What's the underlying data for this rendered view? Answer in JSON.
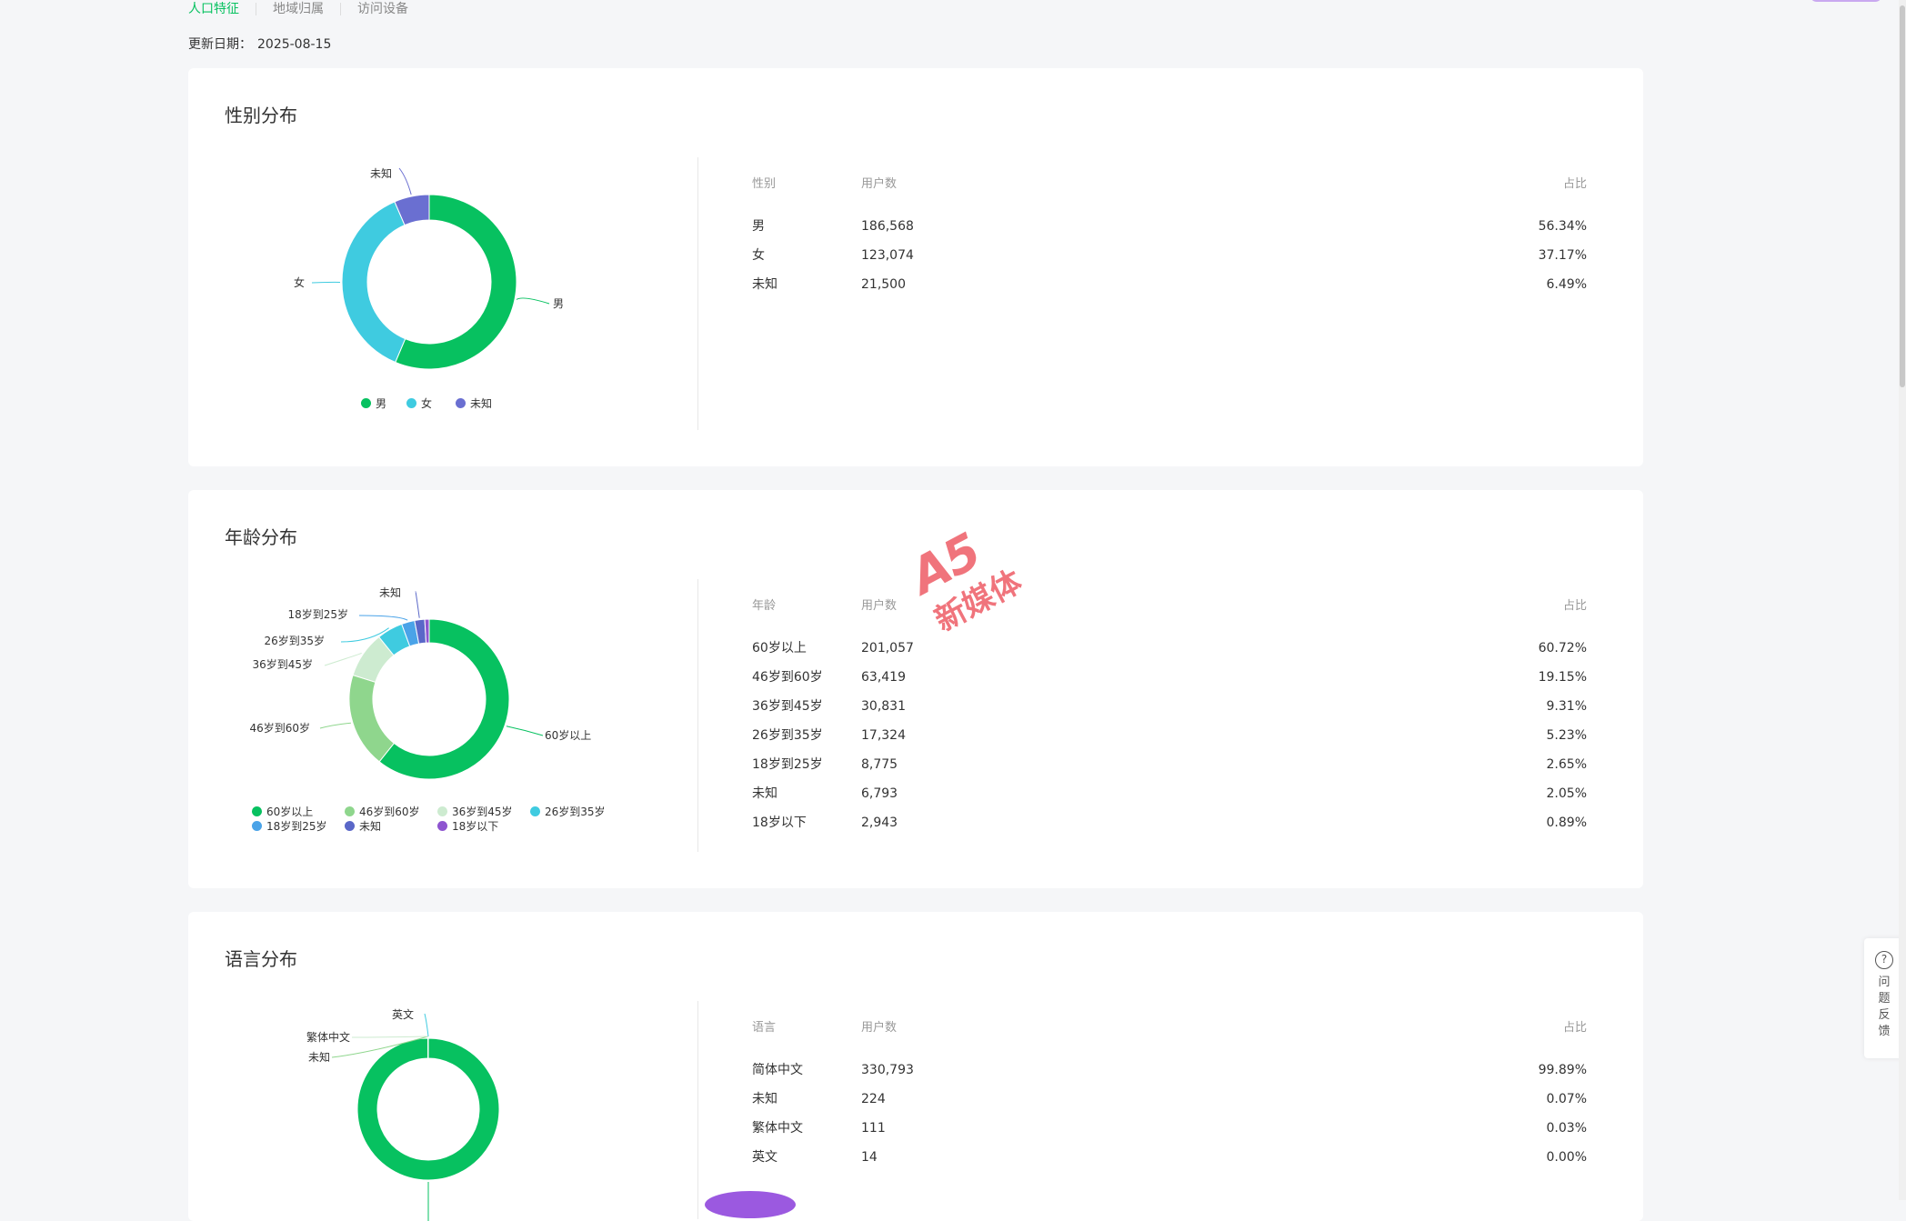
{
  "tabs": [
    "人口特征",
    "地域归属",
    "访问设备"
  ],
  "update": {
    "label": "更新日期：",
    "value": "2025-08-15"
  },
  "gender": {
    "title": "性别分布",
    "headers": [
      "性别",
      "用户数",
      "占比"
    ],
    "rows": [
      [
        "男",
        "186,568",
        "56.34%"
      ],
      [
        "女",
        "123,074",
        "37.17%"
      ],
      [
        "未知",
        "21,500",
        "6.49%"
      ]
    ],
    "legend": [
      "男",
      "女",
      "未知"
    ]
  },
  "age": {
    "title": "年龄分布",
    "headers": [
      "年龄",
      "用户数",
      "占比"
    ],
    "rows": [
      [
        "60岁以上",
        "201,057",
        "60.72%"
      ],
      [
        "46岁到60岁",
        "63,419",
        "19.15%"
      ],
      [
        "36岁到45岁",
        "30,831",
        "9.31%"
      ],
      [
        "26岁到35岁",
        "17,324",
        "5.23%"
      ],
      [
        "18岁到25岁",
        "8,775",
        "2.65%"
      ],
      [
        "未知",
        "6,793",
        "2.05%"
      ],
      [
        "18岁以下",
        "2,943",
        "0.89%"
      ]
    ],
    "legend": [
      "60岁以上",
      "46岁到60岁",
      "36岁到45岁",
      "26岁到35岁",
      "18岁到25岁",
      "未知",
      "18岁以下"
    ],
    "callouts": [
      "60岁以上",
      "46岁到60岁",
      "36岁到45岁",
      "26岁到35岁",
      "18岁到25岁",
      "未知"
    ]
  },
  "language": {
    "title": "语言分布",
    "headers": [
      "语言",
      "用户数",
      "占比"
    ],
    "rows": [
      [
        "简体中文",
        "330,793",
        "99.89%"
      ],
      [
        "未知",
        "224",
        "0.07%"
      ],
      [
        "繁体中文",
        "111",
        "0.03%"
      ],
      [
        "英文",
        "14",
        "0.00%"
      ]
    ],
    "callouts": [
      "英文",
      "繁体中文",
      "未知"
    ]
  },
  "chart_data": [
    {
      "type": "pie",
      "categories": [
        "男",
        "女",
        "未知"
      ],
      "values": [
        56.34,
        37.17,
        6.49
      ],
      "colors": [
        "#07c160",
        "#3fcbe0",
        "#6a6fd1"
      ]
    },
    {
      "type": "pie",
      "categories": [
        "60岁以上",
        "46岁到60岁",
        "36岁到45岁",
        "26岁到35岁",
        "18岁到25岁",
        "未知",
        "18岁以下"
      ],
      "values": [
        60.72,
        19.15,
        9.31,
        5.23,
        2.65,
        2.05,
        0.89
      ],
      "colors": [
        "#07c160",
        "#8fd68d",
        "#cdebd0",
        "#3fcbe0",
        "#4aa3e8",
        "#5a67c8",
        "#8e55d0"
      ]
    },
    {
      "type": "pie",
      "categories": [
        "简体中文",
        "未知",
        "繁体中文",
        "英文"
      ],
      "values": [
        99.89,
        0.07,
        0.03,
        0.0
      ],
      "colors": [
        "#07c160",
        "#8fd68d",
        "#cdebd0",
        "#3fcbe0"
      ]
    }
  ],
  "feedback": {
    "label": "问题反馈"
  },
  "watermark": {
    "big": "A5",
    "small": "新媒体"
  }
}
